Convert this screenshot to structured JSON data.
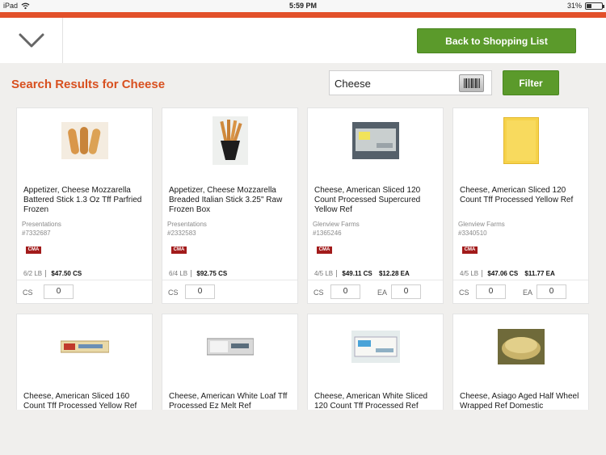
{
  "status_bar": {
    "device": "iPad",
    "time": "5:59 PM",
    "battery": "31%",
    "battery_level": 0.31
  },
  "header": {
    "back_button_label": "Back to Shopping List"
  },
  "search": {
    "title": "Search Results for Cheese",
    "query": "Cheese",
    "filter_label": "Filter"
  },
  "colors": {
    "accent_orange": "#e2502a",
    "title_orange": "#d8501f",
    "button_green": "#5b9a2b",
    "badge_red": "#a21b1b"
  },
  "products": [
    {
      "name": "Appetizer, Cheese Mozzarella Battered Stick 1.3 Oz Tff Parfried Frozen",
      "brand": "Presentations",
      "number": "#7332687",
      "badge": "CMA",
      "pack": "6/2 LB",
      "cs_price": "$47.50 CS",
      "ea_price": "",
      "qty_cs_label": "CS",
      "qty_cs": "0",
      "qty_ea_label": "",
      "qty_ea": "",
      "image": "mozzarella-sticks-image"
    },
    {
      "name": "Appetizer, Cheese Mozzarella Breaded Italian Stick 3.25\" Raw Frozen Box",
      "brand": "Presentations",
      "number": "#2332583",
      "badge": "CMA",
      "pack": "6/4 LB",
      "cs_price": "$92.75 CS",
      "ea_price": "",
      "qty_cs_label": "CS",
      "qty_cs": "0",
      "qty_ea_label": "",
      "qty_ea": "",
      "image": "breaded-sticks-cup-image"
    },
    {
      "name": "Cheese, American Sliced 120 Count Processed Supercured Yellow Ref",
      "brand": "Glenview Farms",
      "number": "#1365246",
      "badge": "CMA",
      "pack": "4/5 LB",
      "cs_price": "$49.11 CS",
      "ea_price": "$12.28 EA",
      "qty_cs_label": "CS",
      "qty_cs": "0",
      "qty_ea_label": "EA",
      "qty_ea": "0",
      "image": "cheese-package-image"
    },
    {
      "name": "Cheese, American Sliced 120 Count Tff Processed Yellow Ref",
      "brand": "Glenview Farms",
      "number": "#3340510",
      "badge": "CMA",
      "pack": "4/5 LB",
      "cs_price": "$47.06 CS",
      "ea_price": "$11.77 EA",
      "qty_cs_label": "CS",
      "qty_cs": "0",
      "qty_ea_label": "EA",
      "qty_ea": "0",
      "image": "yellow-cheese-slice-image"
    },
    {
      "name": "Cheese, American Sliced 160 Count Tff Processed Yellow Ref",
      "image": "cheese-loaf-package-image"
    },
    {
      "name": "Cheese, American White Loaf Tff Processed Ez Melt Ref",
      "image": "white-loaf-package-image"
    },
    {
      "name": "Cheese, American White Sliced 120 Count Tff Processed Ref",
      "image": "white-sliced-package-image"
    },
    {
      "name": "Cheese, Asiago Aged Half Wheel Wrapped Ref Domestic",
      "image": "asiago-wheel-image"
    }
  ]
}
